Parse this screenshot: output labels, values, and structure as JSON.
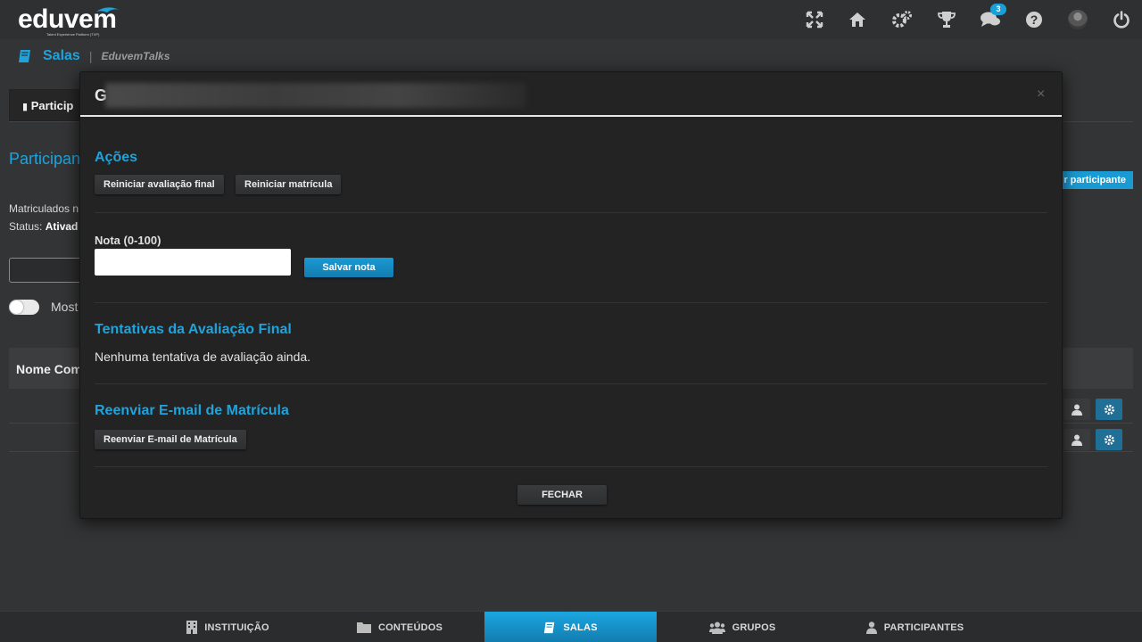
{
  "app": {
    "logo_text": "eduvem",
    "logo_tagline": "Talent Experience Platform (TXP)"
  },
  "topbar": {
    "icons": [
      "fullscreen-icon",
      "home-icon",
      "settings-icon",
      "trophy-icon",
      "chat-icon",
      "help-icon",
      "user-avatar",
      "power-icon"
    ],
    "chat_badge": "3"
  },
  "breadcrumb": {
    "section": "Salas",
    "current": "EduvemTalks"
  },
  "background": {
    "tab_label": "Particip",
    "heading": "Participan",
    "enrolled_label": "Matriculados n",
    "status_label": "Status:",
    "status_value": "Ativad",
    "toggle_label": "Most",
    "table_header": "Nome Com",
    "add_button": "r participante"
  },
  "modal": {
    "title": "G",
    "close_label": "×",
    "actions": {
      "title": "Ações",
      "reset_final_eval": "Reiniciar avaliação final",
      "reset_enrollment": "Reiniciar matrícula"
    },
    "grade": {
      "label": "Nota (0-100)",
      "value": "",
      "save_label": "Salvar nota"
    },
    "attempts": {
      "title": "Tentativas da Avaliação Final",
      "empty_text": "Nenhuma tentativa de avaliação ainda."
    },
    "resend": {
      "title": "Reenviar E-mail de Matrícula",
      "button_label": "Reenviar E-mail de Matrícula"
    },
    "close_button": "FECHAR"
  },
  "bottom_nav": {
    "items": [
      {
        "label": "INSTITUIÇÃO",
        "icon": "building-icon"
      },
      {
        "label": "CONTEÚDOS",
        "icon": "folder-icon"
      },
      {
        "label": "SALAS",
        "icon": "book-icon",
        "active": true
      },
      {
        "label": "GRUPOS",
        "icon": "group-icon"
      },
      {
        "label": "PARTICIPANTES",
        "icon": "user-icon"
      }
    ]
  },
  "colors": {
    "accent": "#1fa3dc",
    "background": "#333435",
    "modal": "#232324"
  }
}
